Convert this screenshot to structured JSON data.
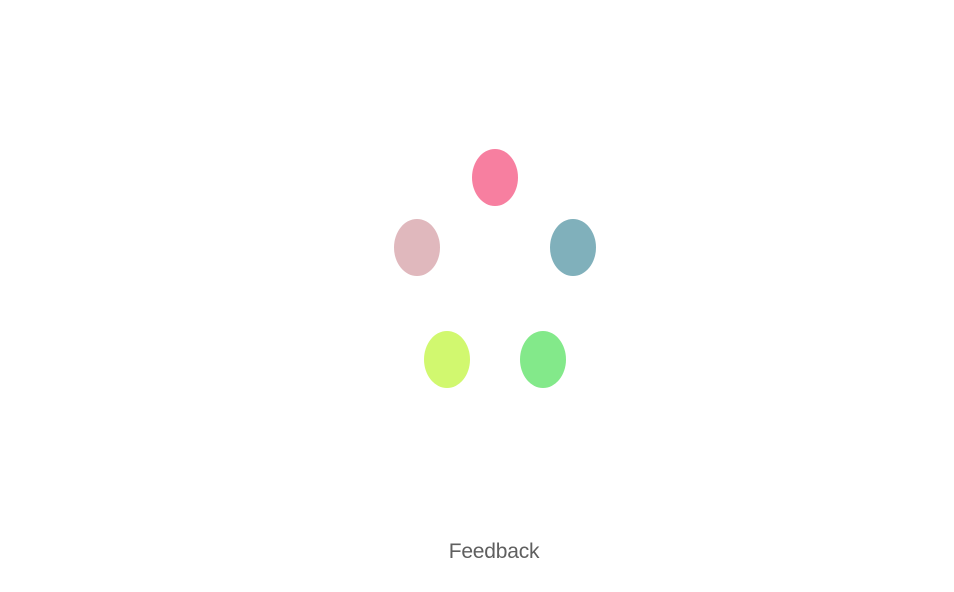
{
  "loader": {
    "dots": [
      {
        "color": "#f77fa0"
      },
      {
        "color": "#e0b8bd"
      },
      {
        "color": "#80b0bb"
      },
      {
        "color": "#d1f86f"
      },
      {
        "color": "#83e98a"
      }
    ]
  },
  "footer": {
    "feedback_label": "Feedback"
  }
}
